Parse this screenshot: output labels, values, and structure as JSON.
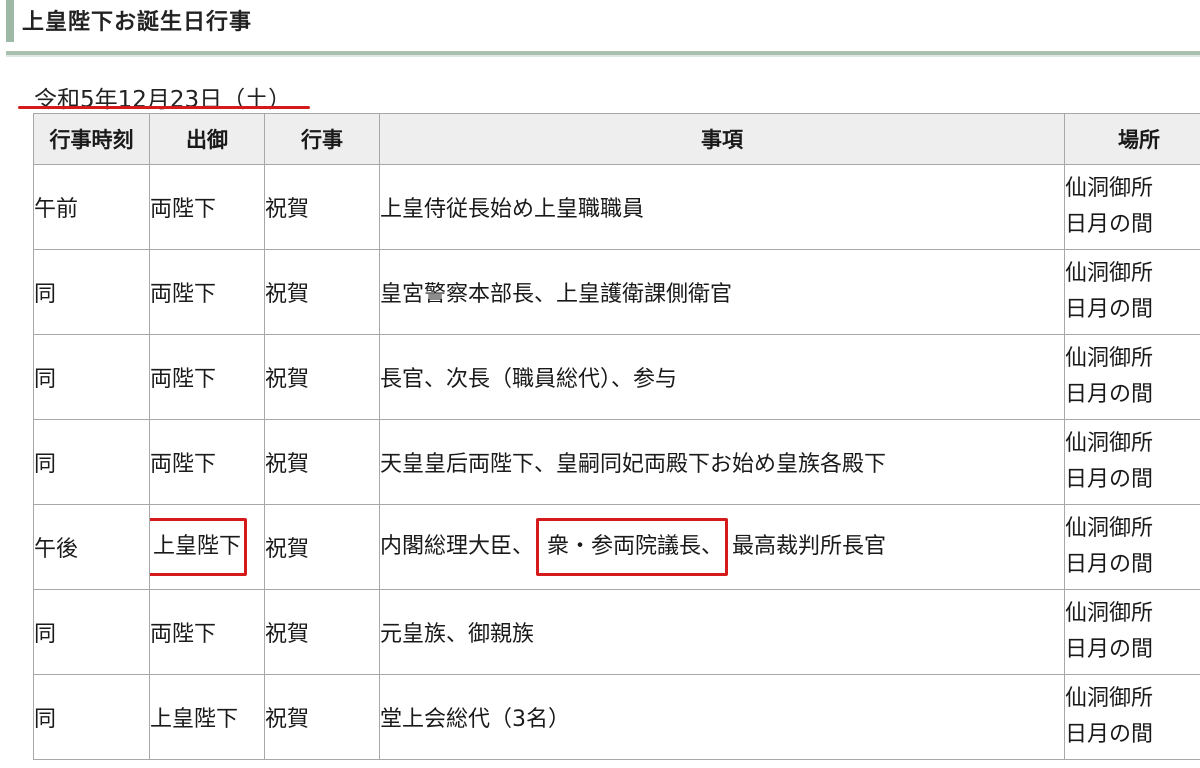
{
  "section": {
    "title": "上皇陛下お誕生日行事",
    "date": "令和5年12月23日（土）"
  },
  "table": {
    "headers": [
      "行事時刻",
      "出御",
      "行事",
      "事項",
      "場所"
    ],
    "rows": [
      {
        "time": "午前",
        "attendance": "両陛下",
        "event": "祝賀",
        "item": "上皇侍従長始め上皇職職員",
        "item_hl": "",
        "item_post": "",
        "place1": "仙洞御所",
        "place2": "日月の間"
      },
      {
        "time": "同",
        "attendance": "両陛下",
        "event": "祝賀",
        "item": "皇宮警察本部長、上皇護衛課側衛官",
        "item_hl": "",
        "item_post": "",
        "place1": "仙洞御所",
        "place2": "日月の間"
      },
      {
        "time": "同",
        "attendance": "両陛下",
        "event": "祝賀",
        "item": "長官、次長（職員総代）、参与",
        "item_hl": "",
        "item_post": "",
        "place1": "仙洞御所",
        "place2": "日月の間"
      },
      {
        "time": "同",
        "attendance": "両陛下",
        "event": "祝賀",
        "item": "天皇皇后両陛下、皇嗣同妃両殿下お始め皇族各殿下",
        "item_hl": "",
        "item_post": "",
        "place1": "仙洞御所",
        "place2": "日月の間"
      },
      {
        "time": "午後",
        "attendance": "上皇陛下",
        "event": "祝賀",
        "item": "内閣総理大臣、",
        "item_hl": "衆・参両院議長、",
        "item_post": "最高裁判所長官",
        "place1": "仙洞御所",
        "place2": "日月の間"
      },
      {
        "time": "同",
        "attendance": "両陛下",
        "event": "祝賀",
        "item": "元皇族、御親族",
        "item_hl": "",
        "item_post": "",
        "place1": "仙洞御所",
        "place2": "日月の間"
      },
      {
        "time": "同",
        "attendance": "上皇陛下",
        "event": "祝賀",
        "item": "堂上会総代（3名）",
        "item_hl": "",
        "item_post": "",
        "place1": "仙洞御所",
        "place2": "日月の間"
      }
    ]
  },
  "highlight_color": "#d41a1a",
  "accent_color": "#9db8a4"
}
